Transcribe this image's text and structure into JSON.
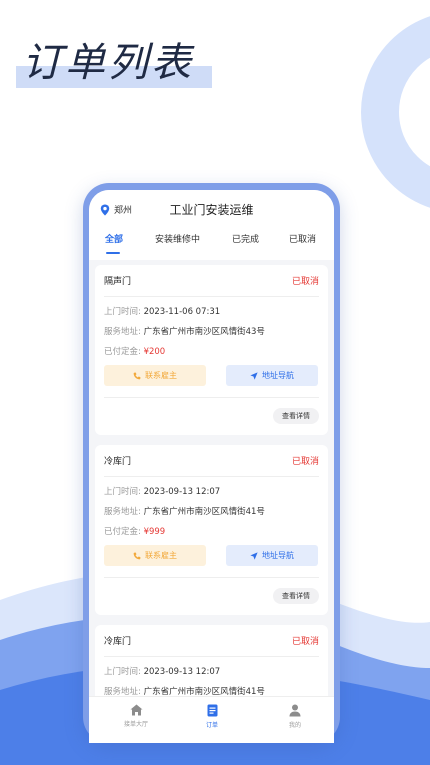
{
  "hero": {
    "title": "订单列表"
  },
  "app": {
    "city": "郑州",
    "title": "工业门安装运维"
  },
  "tabs": [
    {
      "label": "全部"
    },
    {
      "label": "安装维修中"
    },
    {
      "label": "已完成"
    },
    {
      "label": "已取消"
    }
  ],
  "labels": {
    "visit_time": "上门时间:",
    "service_address": "服务地址:",
    "deposit_paid": "已付定金:",
    "contact_owner": "联系雇主",
    "nav_address": "地址导航",
    "view_detail": "查看详情"
  },
  "orders": [
    {
      "name": "隔声门",
      "status": "已取消",
      "time": "2023-11-06 07:31",
      "address": "广东省广州市南沙区风情街43号",
      "deposit": "¥200"
    },
    {
      "name": "冷库门",
      "status": "已取消",
      "time": "2023-09-13 12:07",
      "address": "广东省广州市南沙区风情街41号",
      "deposit": "¥999"
    },
    {
      "name": "冷库门",
      "status": "已取消",
      "time": "2023-09-13 12:07",
      "address": "广东省广州市南沙区风情街41号",
      "deposit": ""
    }
  ],
  "bottom_nav": [
    {
      "label": "接单大厅",
      "icon": "home-icon"
    },
    {
      "label": "订单",
      "icon": "document-icon"
    },
    {
      "label": "我的",
      "icon": "person-icon"
    }
  ],
  "colors": {
    "accent": "#2f6fe8",
    "status_red": "#e53935",
    "phone_frame": "#7f9ee8",
    "contact_bg": "#fdf1dc",
    "nav_bg": "#e4ecfc"
  }
}
